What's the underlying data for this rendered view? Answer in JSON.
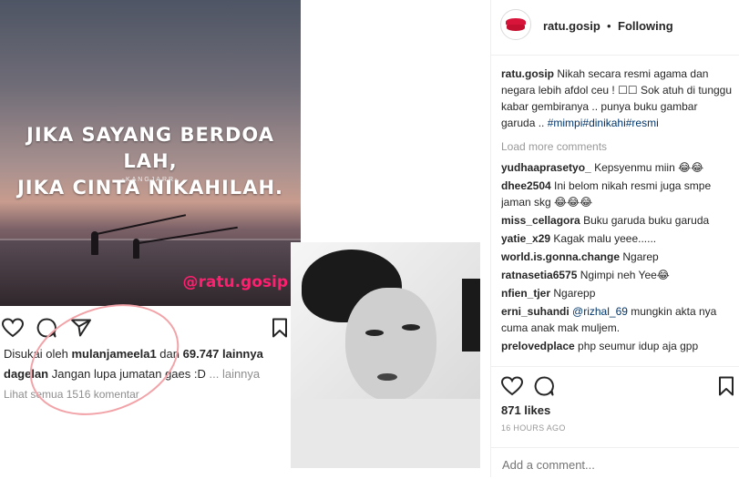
{
  "post_image": {
    "quote_line1": "JIKA SAYANG BERDOA LAH,",
    "quote_line2": "JIKA CINTA NIKAHILAH.",
    "quote_author": "-KANGJARR-",
    "watermark": "@ratu.gosip",
    "likes_prefix": "Disukai oleh",
    "likes_user": "mulanjameela1",
    "likes_mid": "dan",
    "likes_count": "69.747 lainnya",
    "caption_user": "dagelan",
    "caption_text": "Jangan lupa jumatan gaes :D",
    "caption_more": "... lainnya",
    "view_comments": "Lihat semua 1516 komentar"
  },
  "header": {
    "username": "ratu.gosip",
    "separator": "•",
    "follow_status": "Following"
  },
  "caption": {
    "username": "ratu.gosip",
    "text": "Nikah secara resmi agama dan negara lebih afdol ceu ! ☐☐ Sok atuh di tunggu kabar gembiranya .. punya buku gambar garuda ..",
    "hashtags": "#mimpi#dinikahi#resmi"
  },
  "load_more": "Load more comments",
  "comments": [
    {
      "user": "yudhaaprasetyo_",
      "text": "Kepsyenmu miin 😂😂"
    },
    {
      "user": "dhee2504",
      "text": "Ini belom nikah resmi juga smpe jaman skg 😂😂😂"
    },
    {
      "user": "miss_cellagora",
      "text": "Buku garuda buku garuda"
    },
    {
      "user": "yatie_x29",
      "text": "Kagak malu yeee......"
    },
    {
      "user": "world.is.gonna.change",
      "text": "Ngarep"
    },
    {
      "user": "ratnasetia6575",
      "text": "Ngimpi neh Yee😂"
    },
    {
      "user": "nfien_tjer",
      "text": "Ngarepp"
    },
    {
      "user": "erni_suhandi",
      "mention": "@rizhal_69",
      "text": "mungkin akta nya cuma anak mak muljem."
    },
    {
      "user": "prelovedplace",
      "text": "php seumur idup aja gpp"
    }
  ],
  "likes": "871 likes",
  "timestamp": "16 HOURS AGO",
  "comment_input": {
    "placeholder": "Add a comment..."
  },
  "icons": [
    "heart-icon",
    "comment-icon",
    "share-icon",
    "bookmark-icon"
  ],
  "colors": {
    "watermark": "#ff1f6e",
    "hashtag": "#003569",
    "brand_lips": "#d8143a"
  }
}
